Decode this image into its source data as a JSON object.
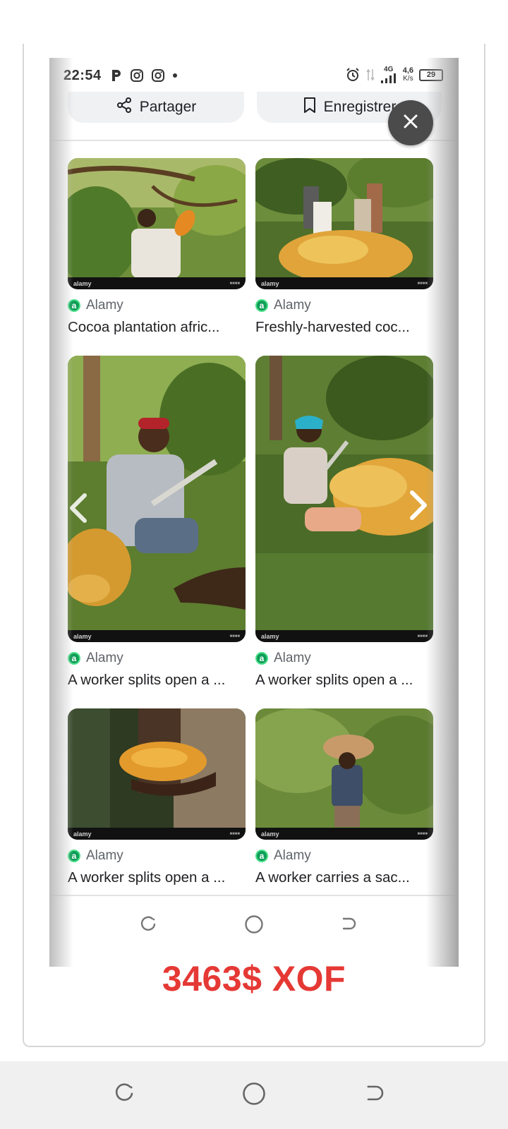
{
  "status_bar": {
    "time": "22:54",
    "network": "4G",
    "speed_value": "4,6",
    "speed_unit": "K/s",
    "battery": "29",
    "icons": [
      "p-icon",
      "instagram-icon",
      "instagram-icon",
      "dot-icon",
      "alarm-icon",
      "data-arrows-icon",
      "signal-icon",
      "battery-icon"
    ]
  },
  "actions": {
    "share_label": "Partager",
    "save_label": "Enregistrer"
  },
  "results": [
    {
      "source": "Alamy",
      "caption": "Cocoa plantation afric...",
      "watermark": "alamy"
    },
    {
      "source": "Alamy",
      "caption": "Freshly-harvested coc...",
      "watermark": "alamy"
    },
    {
      "source": "Alamy",
      "caption": "A worker splits open a ...",
      "watermark": "alamy"
    },
    {
      "source": "Alamy",
      "caption": "A worker splits open a ...",
      "watermark": "alamy"
    },
    {
      "source": "Alamy",
      "caption": "A worker splits open a ...",
      "watermark": "alamy"
    },
    {
      "source": "Alamy",
      "caption": "A worker carries a sac...",
      "watermark": "alamy"
    }
  ],
  "price": "3463$ XOF",
  "colors": {
    "price": "#e53935",
    "close_button": "#4b4b4b",
    "pill_bg": "#f0f1f3",
    "source_logo": "#0f9d58"
  }
}
